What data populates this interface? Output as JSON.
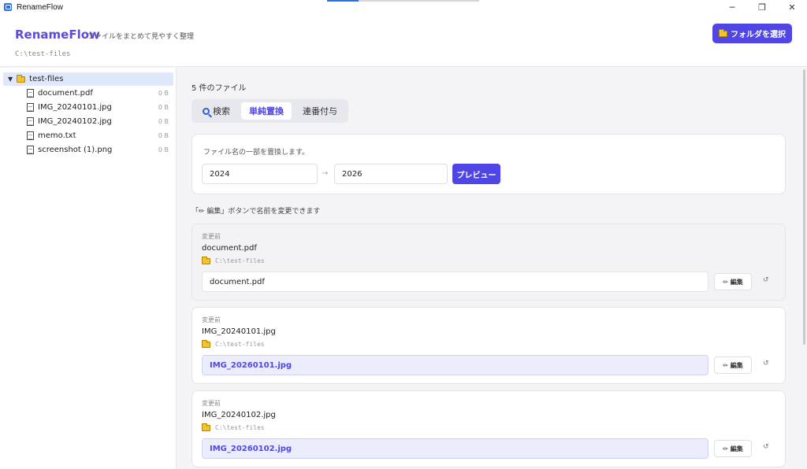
{
  "window": {
    "title": "RenameFlow",
    "minimize_glyph": "─",
    "maximize_glyph": "❐",
    "close_glyph": "✕"
  },
  "header": {
    "brand": "RenameFlow",
    "tagline": "ファイルをまとめて見やすく整理",
    "path": "C:\\test-files",
    "select_folder_label": "フォルダを選択"
  },
  "sidebar": {
    "root": {
      "caret": "▼",
      "label": "test-files"
    },
    "files": [
      {
        "name": "document.pdf",
        "size": "0 B"
      },
      {
        "name": "IMG_20240101.jpg",
        "size": "0 B"
      },
      {
        "name": "IMG_20240102.jpg",
        "size": "0 B"
      },
      {
        "name": "memo.txt",
        "size": "0 B"
      },
      {
        "name": "screenshot (1).png",
        "size": "0 B"
      }
    ]
  },
  "main": {
    "file_count": "5 件のファイル",
    "tabs": [
      {
        "label": "検索",
        "icon": "search-icon",
        "active": false
      },
      {
        "label": "単純置換",
        "active": true
      },
      {
        "label": "連番付与",
        "active": false
      }
    ],
    "replace": {
      "description": "ファイル名の一部を置換します。",
      "find_value": "2024",
      "arrow": "→",
      "replace_value": "2026",
      "preview_label": "プレビュー"
    },
    "edit_hint": "「✏ 編集」ボタンで名前を変更できます",
    "cards": [
      {
        "before_label": "変更前",
        "original": "document.pdf",
        "path": "C:\\test-files",
        "new_name": "document.pdf",
        "changed": false,
        "edit_label": "✏ 編集",
        "reset_glyph": "↺"
      },
      {
        "before_label": "変更前",
        "original": "IMG_20240101.jpg",
        "path": "C:\\test-files",
        "new_name": "IMG_20260101.jpg",
        "changed": true,
        "edit_label": "✏ 編集",
        "reset_glyph": "↺"
      },
      {
        "before_label": "変更前",
        "original": "IMG_20240102.jpg",
        "path": "C:\\test-files",
        "new_name": "IMG_20260102.jpg",
        "changed": true,
        "edit_label": "✏ 編集",
        "reset_glyph": "↺"
      }
    ]
  },
  "colors": {
    "accent": "#4f46e5",
    "brand": "#5b4bd8",
    "selected_row": "#dfe8fb",
    "changed_field": "#ecedfc"
  }
}
